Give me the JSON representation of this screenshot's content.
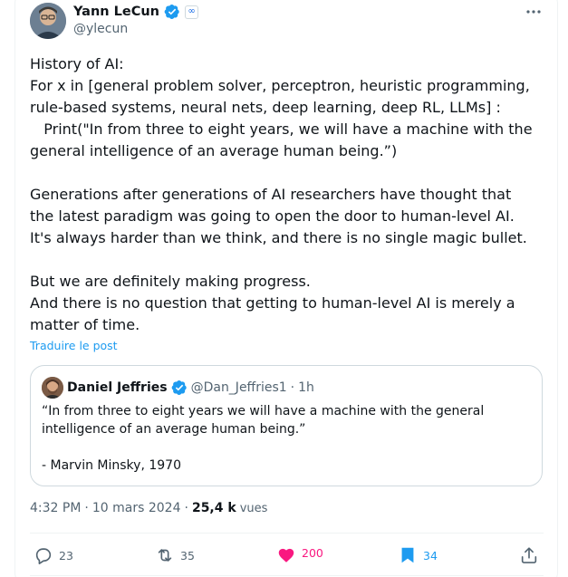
{
  "author": {
    "display_name": "Yann LeCun",
    "handle": "@ylecun",
    "affiliation_badge": "∞",
    "verified_color": "#1d9bf0"
  },
  "post": {
    "text": "History of AI:\nFor x in [general problem solver, perceptron, heuristic programming, rule-based systems, neural nets, deep learning, deep RL, LLMs] :\n   Print(\"In from three to eight years, we will have a machine with the general intelligence of an average human being.”)\n\nGenerations after generations of AI researchers have thought that the latest paradigm was going to open the door to human-level AI.\nIt's always harder than we think, and there is no single magic bullet.\n\nBut we are definitely making progress.\nAnd there is no question that getting to human-level AI is merely a matter of time.",
    "translate_label": "Traduire le post",
    "time": "4:32 PM",
    "date": "10 mars 2024",
    "separator": "·",
    "views_count": "25,4 k",
    "views_label": "vues"
  },
  "quote": {
    "display_name": "Daniel Jeffries",
    "handle": "@Dan_Jeffries1",
    "separator": "·",
    "time": "1h",
    "text": "“In from three to eight years we will have a machine with the general intelligence of an average human being.”\n\n- Marvin Minsky, 1970"
  },
  "actions": {
    "replies": "23",
    "reposts": "35",
    "likes": "200",
    "bookmarks": "34"
  },
  "colors": {
    "accent": "#1d9bf0",
    "like": "#f91880",
    "secondary_text": "#536471"
  },
  "icons": [
    "more-icon",
    "verified-icon",
    "reply-icon",
    "repost-icon",
    "heart-icon",
    "bookmark-icon",
    "share-icon"
  ]
}
